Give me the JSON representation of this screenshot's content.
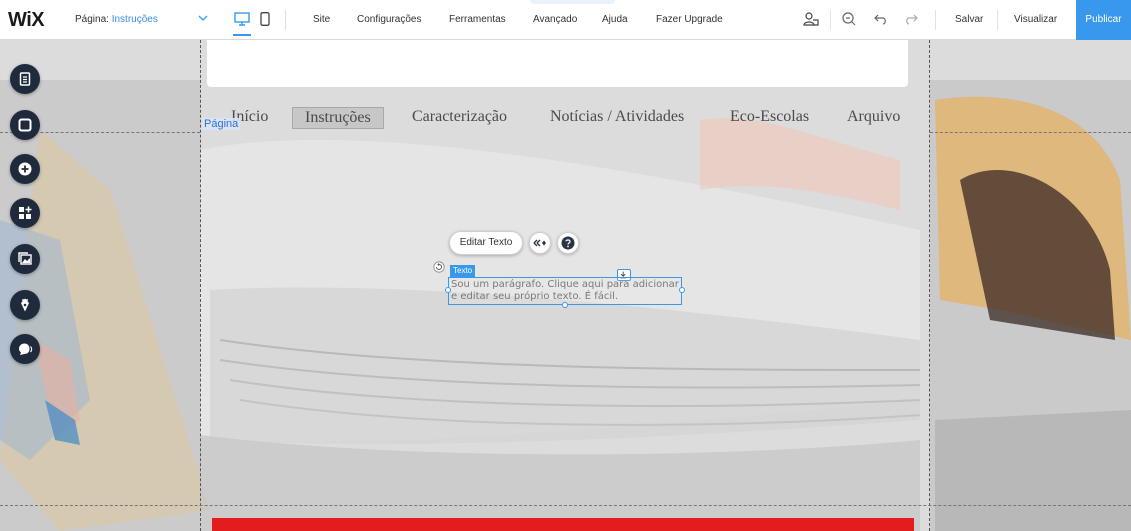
{
  "topbar": {
    "logo": "WiX",
    "page_label": "Página:",
    "page_value": "Instruções",
    "menu": [
      "Site",
      "Configurações",
      "Ferramentas",
      "Avançado",
      "Ajuda",
      "Fazer Upgrade"
    ],
    "save": "Salvar",
    "preview": "Visualizar",
    "publish": "Publicar",
    "accent_color": "#3899ec"
  },
  "stage": {
    "nav": [
      "Início",
      "Instruções",
      "Caracterização",
      "Notícias / Atividades",
      "Eco-Escolas",
      "Arquivo"
    ],
    "active_nav": "Instruções",
    "page_tag": "Página",
    "editor": {
      "edit_text_button": "Editar Texto",
      "element_tag": "Texto",
      "paragraph": "Sou um parágrafo. Clique aqui para adicionar e editar seu próprio texto. É fácil."
    },
    "footer_color": "#e31d1d"
  },
  "icons": {
    "left_rail": [
      "pages-icon",
      "background-icon",
      "add-icon",
      "apps-icon",
      "media-icon",
      "pen-icon",
      "chat-icon"
    ],
    "toolbar": [
      "desktop-icon",
      "mobile-icon",
      "people-icon",
      "zoom-out-icon",
      "undo-icon",
      "redo-icon"
    ]
  }
}
